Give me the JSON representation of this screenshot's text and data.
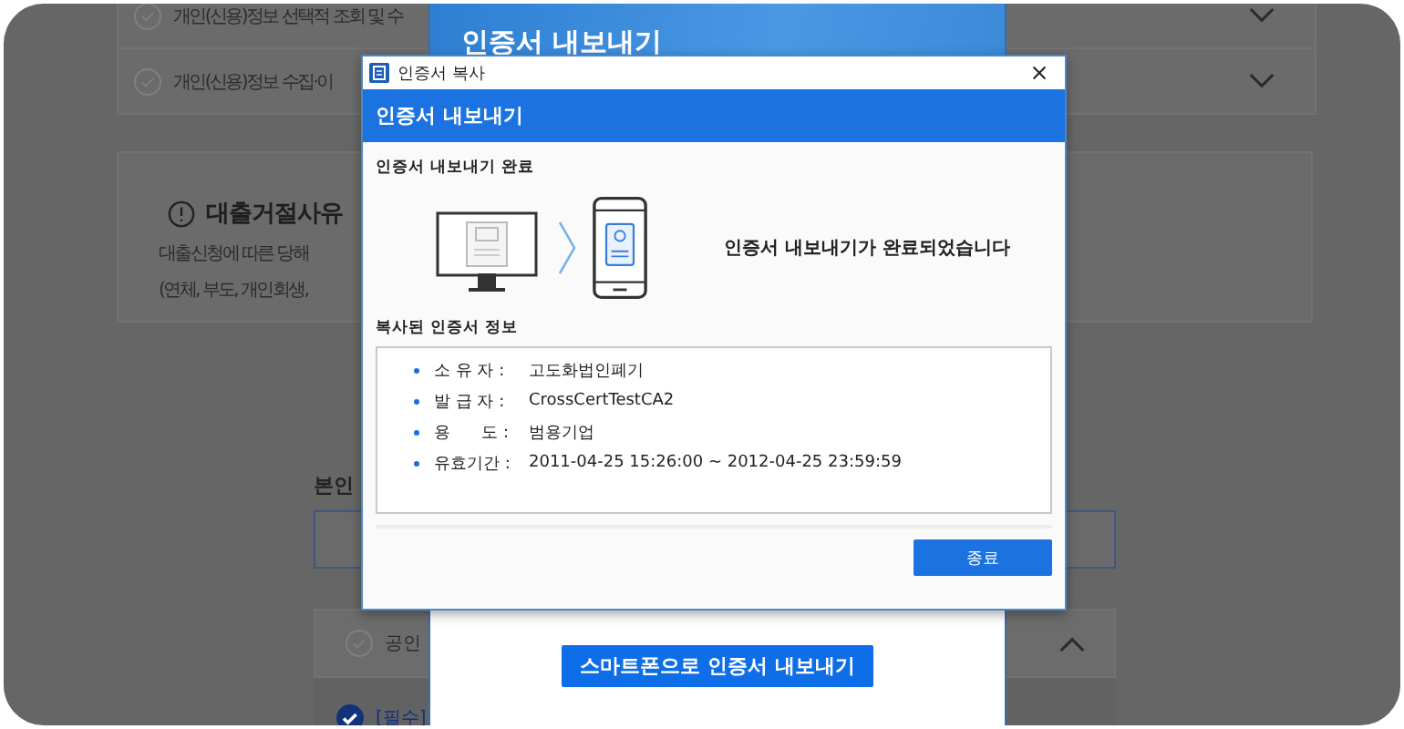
{
  "background_page": {
    "agreements": [
      {
        "label": "개인(신용)정보 선택적 조회 및 수",
        "checked": false
      },
      {
        "label": "개인(신용)정보 수집·이",
        "checked": false
      }
    ],
    "notice": {
      "title": "대출거절사유",
      "lines": [
        "대출신청에 따른 당해",
        "(연체, 부도, 개인회생,"
      ]
    },
    "identity_label": "본인",
    "cert_section": {
      "label": "공인",
      "checked": false,
      "expanded": true
    },
    "required_item": {
      "label": "[필수]",
      "checked": true
    }
  },
  "export_modal": {
    "title": "인증서 내보내기",
    "button": "스마트폰으로 인증서 내보내기"
  },
  "dialog": {
    "window_title": "인증서 복사",
    "header": "인증서 내보내기",
    "status_label": "인증서 내보내기 완료",
    "message": "인증서 내보내기가 완료되었습니다",
    "info_label": "복사된 인증서 정보",
    "info": [
      {
        "label": "소 유 자 :",
        "value": "고도화법인폐기"
      },
      {
        "label": "발 급 자 :",
        "value": "CrossCertTestCA2"
      },
      {
        "label": "용      도 :",
        "value": "범용기업"
      },
      {
        "label": "유효기간 :",
        "value": "2011-04-25 15:26:00 ~ 2012-04-25 23:59:59"
      }
    ],
    "button": "종료"
  }
}
